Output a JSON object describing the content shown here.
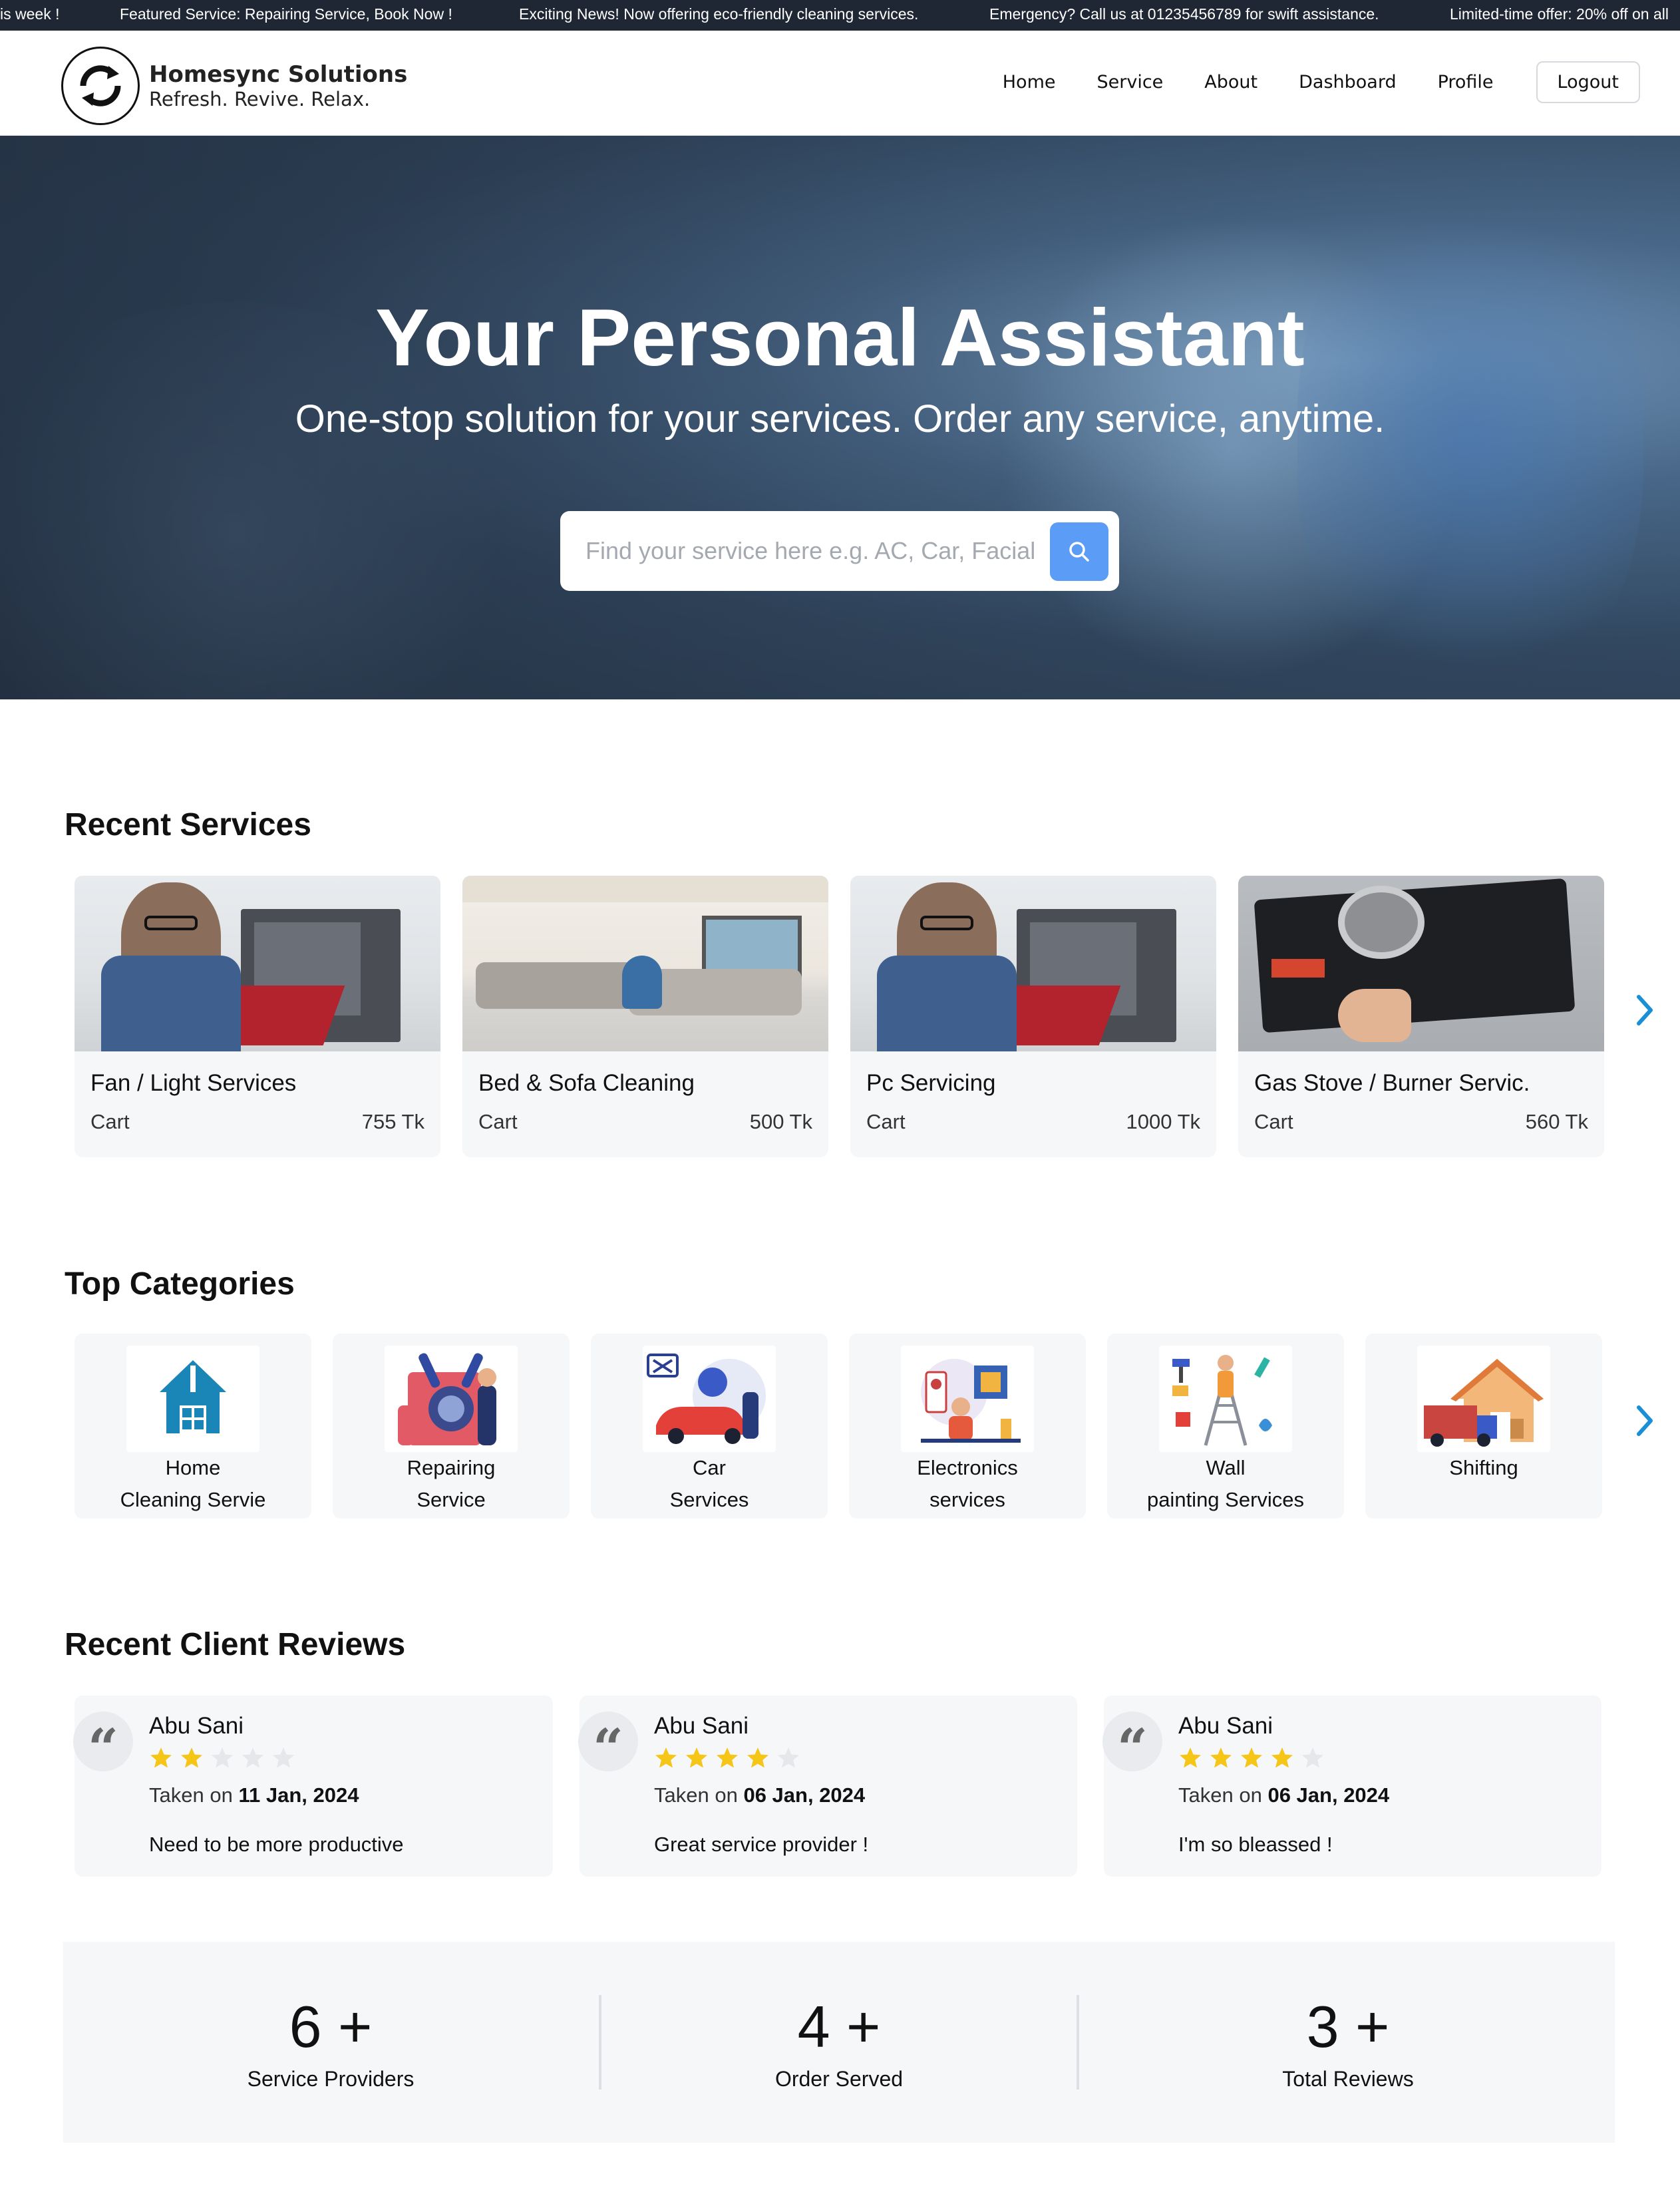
{
  "ticker": [
    "is week !",
    "Featured Service: Repairing Service, Book Now !",
    "Exciting News! Now offering eco-friendly cleaning services.",
    "Emergency? Call us at 01235456789 for swift assistance.",
    "Limited-time offer: 20% off on all"
  ],
  "brand": {
    "name": "Homesync Solutions",
    "tagline": "Refresh. Revive. Relax."
  },
  "nav": {
    "items": [
      "Home",
      "Service",
      "About",
      "Dashboard",
      "Profile"
    ],
    "logout": "Logout"
  },
  "hero": {
    "title": "Your Personal Assistant",
    "subtitle": "One-stop solution for your services. Order any service, anytime.",
    "search_placeholder": "Find your service here e.g. AC, Car, Facial ...",
    "search_icon": "search-icon"
  },
  "recent_services": {
    "title": "Recent Services",
    "items": [
      {
        "name": "Fan / Light Services",
        "cart": "Cart",
        "price": "755 Tk",
        "image": "technician-repairing-pc"
      },
      {
        "name": "Bed & Sofa Cleaning",
        "cart": "Cart",
        "price": "500 Tk",
        "image": "sofa-cleaning"
      },
      {
        "name": "Pc Servicing",
        "cart": "Cart",
        "price": "1000 Tk",
        "image": "technician-repairing-pc"
      },
      {
        "name": "Gas Stove / Burner Servic.",
        "cart": "Cart",
        "price": "560 Tk",
        "image": "gas-stove-repair"
      }
    ]
  },
  "top_categories": {
    "title": "Top Categories",
    "items": [
      {
        "line1": "Home",
        "line2": "Cleaning Servie"
      },
      {
        "line1": "Repairing",
        "line2": "Service"
      },
      {
        "line1": "Car",
        "line2": "Services"
      },
      {
        "line1": "Electronics",
        "line2": "services"
      },
      {
        "line1": "Wall",
        "line2": "painting Services"
      },
      {
        "line1": "Shifting",
        "line2": ""
      }
    ]
  },
  "reviews": {
    "title": "Recent Client Reviews",
    "items": [
      {
        "name": "Abu Sani",
        "rating": 2,
        "taken_prefix": "Taken on",
        "date": "11 Jan, 2024",
        "text": "Need to be more productive"
      },
      {
        "name": "Abu Sani",
        "rating": 4,
        "taken_prefix": "Taken on",
        "date": "06 Jan, 2024",
        "text": "Great service provider !"
      },
      {
        "name": "Abu Sani",
        "rating": 4,
        "taken_prefix": "Taken on",
        "date": "06 Jan, 2024",
        "text": "I'm so bleassed !"
      }
    ]
  },
  "stats": [
    {
      "number": "6 +",
      "label": "Service Providers"
    },
    {
      "number": "4 +",
      "label": "Order Served"
    },
    {
      "number": "3 +",
      "label": "Total Reviews"
    }
  ],
  "colors": {
    "ticker_bg": "#1e2733",
    "accent": "#5b9cf6",
    "star": "#f5c518",
    "star_empty": "#e6e7ea",
    "arrow": "#1a8fd6",
    "card_bg": "#f6f7f9"
  }
}
